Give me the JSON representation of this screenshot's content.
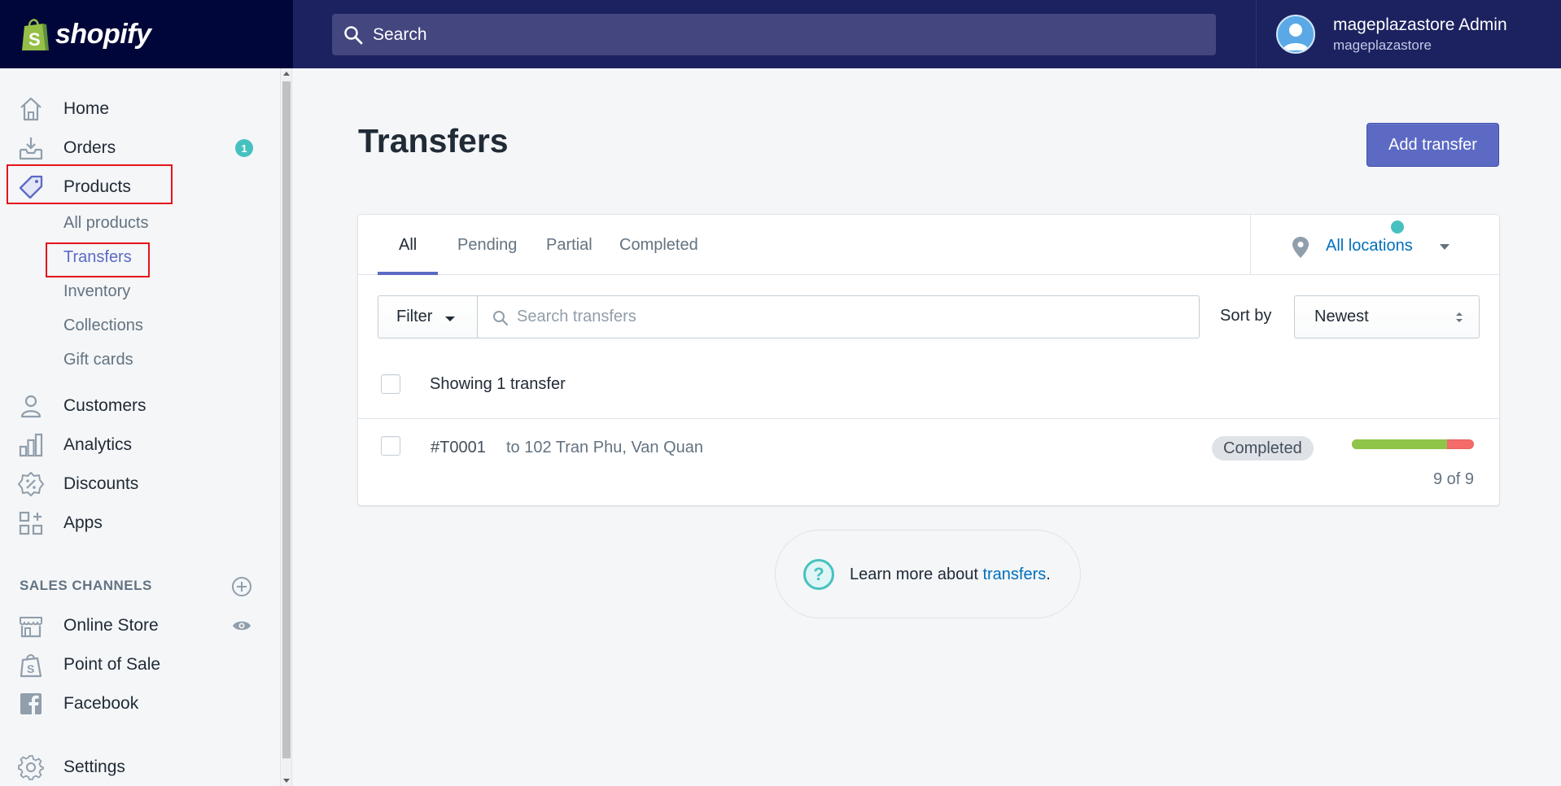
{
  "brand": {
    "name": "shopify"
  },
  "topbar": {
    "search_placeholder": "Search",
    "user_name": "mageplazastore Admin",
    "user_store": "mageplazastore"
  },
  "sidebar": {
    "items": [
      {
        "label": "Home",
        "icon": "home-icon"
      },
      {
        "label": "Orders",
        "icon": "orders-icon",
        "badge": "1"
      },
      {
        "label": "Products",
        "icon": "tag-icon"
      },
      {
        "label": "Customers",
        "icon": "person-icon"
      },
      {
        "label": "Analytics",
        "icon": "bar-chart-icon"
      },
      {
        "label": "Discounts",
        "icon": "discount-icon"
      },
      {
        "label": "Apps",
        "icon": "apps-icon"
      }
    ],
    "product_subitems": [
      "All products",
      "Transfers",
      "Inventory",
      "Collections",
      "Gift cards"
    ],
    "sales_channels_heading": "SALES CHANNELS",
    "channels": [
      {
        "label": "Online Store",
        "icon": "store-icon"
      },
      {
        "label": "Point of Sale",
        "icon": "pos-bag-icon"
      },
      {
        "label": "Facebook",
        "icon": "facebook-icon"
      }
    ],
    "settings_label": "Settings"
  },
  "main": {
    "title": "Transfers",
    "add_button": "Add transfer",
    "tabs": [
      "All",
      "Pending",
      "Partial",
      "Completed"
    ],
    "location_filter": "All locations",
    "filter_button": "Filter",
    "search_placeholder": "Search transfers",
    "sort_label": "Sort by",
    "sort_value": "Newest",
    "showing_text": "Showing 1 transfer",
    "rows": [
      {
        "id": "#T0001",
        "destination": "to 102 Tran Phu, Van Quan",
        "status": "Completed",
        "count": "9 of 9",
        "progress_fraction": 0.78
      }
    ],
    "help_text": "Learn more about ",
    "help_link": "transfers",
    "help_period": "."
  },
  "colors": {
    "accent": "#5c6ac4",
    "topbar": "#1c2260",
    "brand_bg": "#000639",
    "teal": "#47c1bf",
    "link": "#006fbb",
    "highlight": "#e4141b"
  }
}
